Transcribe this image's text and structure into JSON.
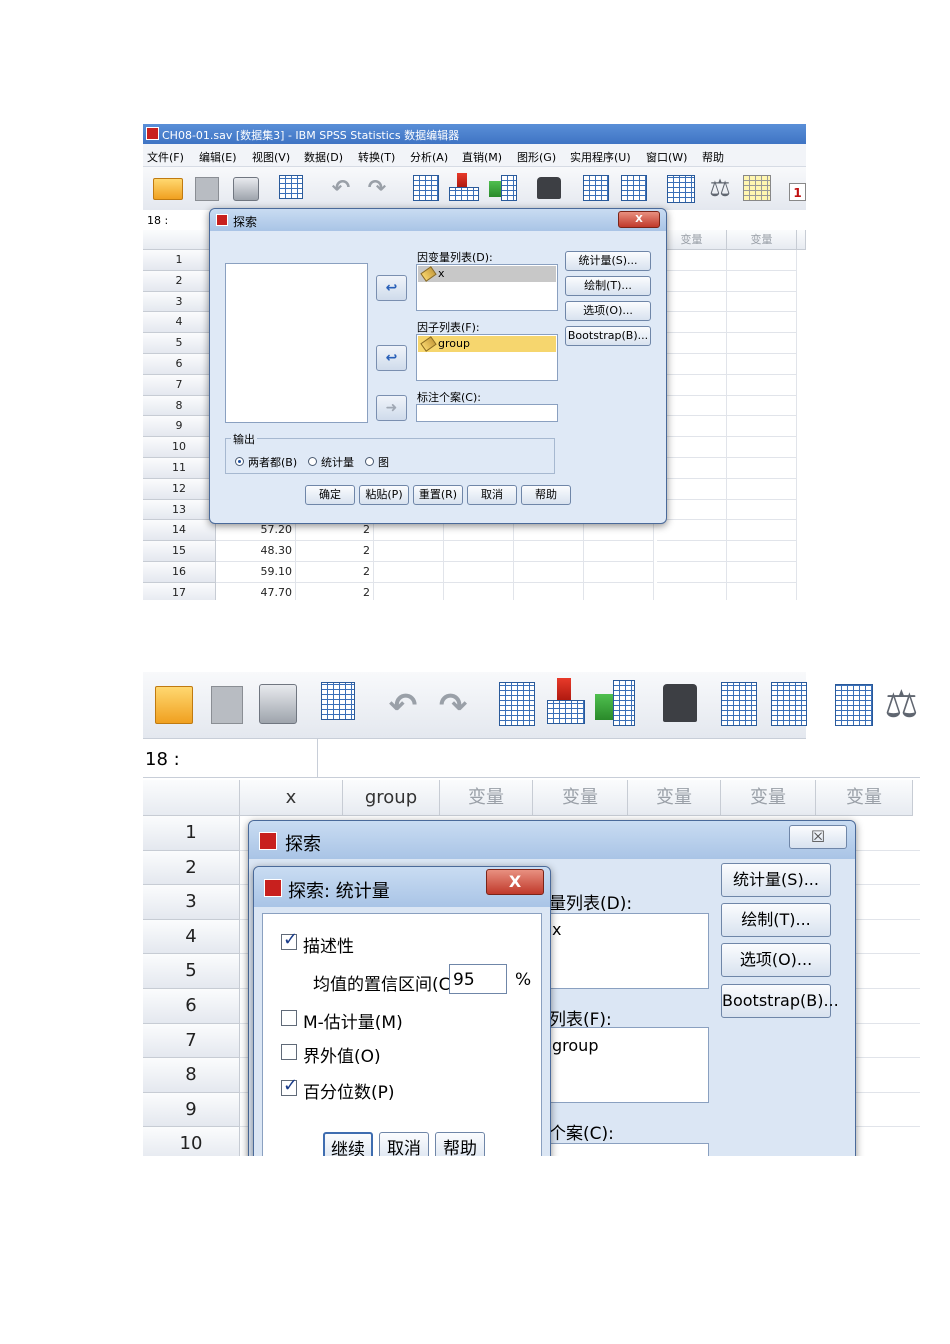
{
  "window": {
    "title": "CH08-01.sav [数据集3] - IBM SPSS Statistics 数据编辑器"
  },
  "menu": [
    "文件(F)",
    "编辑(E)",
    "视图(V)",
    "数据(D)",
    "转换(T)",
    "分析(A)",
    "直销(M)",
    "图形(G)",
    "实用程序(U)",
    "窗口(W)",
    "帮助"
  ],
  "toolbar_icons": [
    "open-folder-icon",
    "save-icon",
    "print-icon",
    "dialog-recall-icon",
    "undo-icon",
    "redo-icon",
    "goto-case-icon",
    "goto-variable-icon",
    "variables-icon",
    "find-icon",
    "insert-cases-icon",
    "insert-variable-icon",
    "split-file-icon",
    "weight-cases-icon",
    "select-cases-icon"
  ],
  "toolbar_extra_label": "1",
  "cell_ref": "18 :",
  "grid": {
    "columns": [
      "x",
      "group",
      "变量",
      "变量",
      "变量",
      "变量",
      "变量"
    ],
    "visible_cols_shot1": [
      "变量",
      "变量"
    ],
    "rows": [
      "1",
      "2",
      "3",
      "4",
      "5",
      "6",
      "7",
      "8",
      "9",
      "10",
      "11",
      "12",
      "13",
      "14",
      "15",
      "16",
      "17"
    ],
    "data_rows": [
      {
        "row": "14",
        "x": "57.20",
        "group": "2"
      },
      {
        "row": "15",
        "x": "48.30",
        "group": "2"
      },
      {
        "row": "16",
        "x": "59.10",
        "group": "2"
      },
      {
        "row": "17",
        "x": "47.70",
        "group": "2"
      }
    ]
  },
  "explore_dialog": {
    "title": "探索",
    "close_label": "X",
    "dependent_list_label": "因变量列表(D):",
    "dependent_items": [
      "x"
    ],
    "factor_list_label": "因子列表(F):",
    "factor_items": [
      "group"
    ],
    "label_cases_label": "标注个案(C):",
    "output_group_label": "输出",
    "output_options": [
      "两者都(B)",
      "统计量",
      "图"
    ],
    "selected_output": "两者都(B)",
    "side_buttons": [
      "统计量(S)...",
      "绘制(T)...",
      "选项(O)...",
      "Bootstrap(B)..."
    ],
    "bottom_buttons": [
      "确定",
      "粘贴(P)",
      "重置(R)",
      "取消",
      "帮助"
    ]
  },
  "shot2": {
    "cell_ref": "18 :",
    "columns": [
      "x",
      "group",
      "变量",
      "变量",
      "变量",
      "变量",
      "变量"
    ],
    "rows": [
      "1",
      "2",
      "3",
      "4",
      "5",
      "6",
      "7",
      "8",
      "9",
      "10"
    ],
    "explore_title": "探索",
    "close_label": "☒",
    "partial_labels": {
      "dependent": "量列表(D):",
      "dependent_item": "x",
      "factor": "列表(F):",
      "factor_item": "group",
      "cases": "个案(C):"
    },
    "side_buttons": [
      "统计量(S)...",
      "绘制(T)...",
      "选项(O)...",
      "Bootstrap(B)..."
    ],
    "stats_dialog": {
      "title": "探索: 统计量",
      "close_label": "X",
      "descriptives": {
        "label": "描述性",
        "checked": true
      },
      "ci_label": "均值的置信区间(C):",
      "ci_value": "95",
      "ci_unit": "%",
      "m_estimators": {
        "label": "M-估计量(M)",
        "checked": false
      },
      "outliers": {
        "label": "界外值(O)",
        "checked": false
      },
      "percentiles": {
        "label": "百分位数(P)",
        "checked": true
      },
      "buttons": [
        "继续",
        "取消",
        "帮助"
      ]
    }
  }
}
